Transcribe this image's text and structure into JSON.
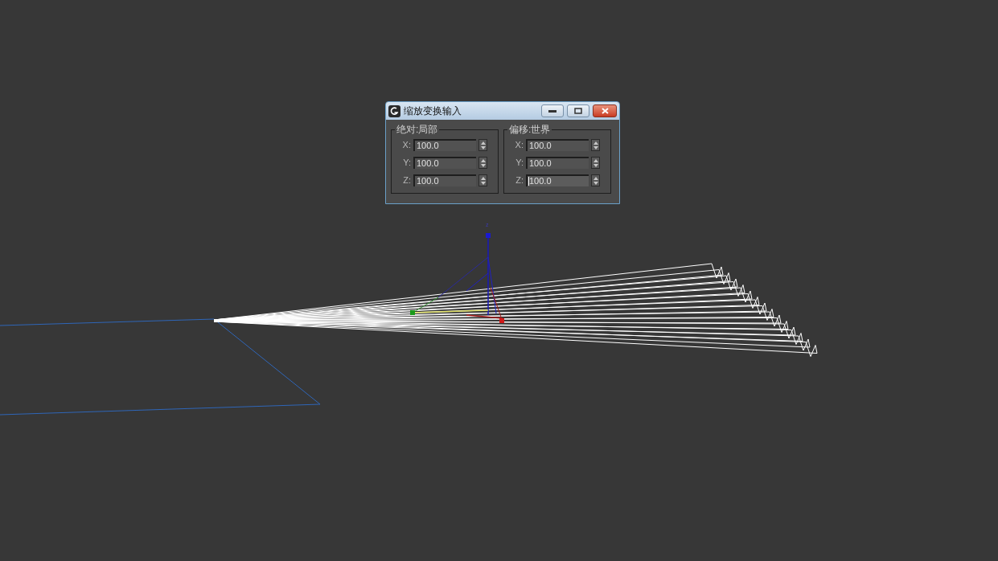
{
  "window": {
    "title": "缩放变换输入"
  },
  "groups": [
    {
      "title": "绝对:局部",
      "fields": [
        {
          "label": "X:",
          "value": "100.0",
          "focused": false
        },
        {
          "label": "Y:",
          "value": "100.0",
          "focused": false
        },
        {
          "label": "Z:",
          "value": "100.0",
          "focused": false
        }
      ]
    },
    {
      "title": "偏移:世界",
      "fields": [
        {
          "label": "X:",
          "value": "100.0",
          "focused": false
        },
        {
          "label": "Y:",
          "value": "100.0",
          "focused": false
        },
        {
          "label": "Z:",
          "value": "100.0",
          "focused": true
        }
      ]
    }
  ],
  "viewport": {
    "gizmo_label": "z"
  }
}
